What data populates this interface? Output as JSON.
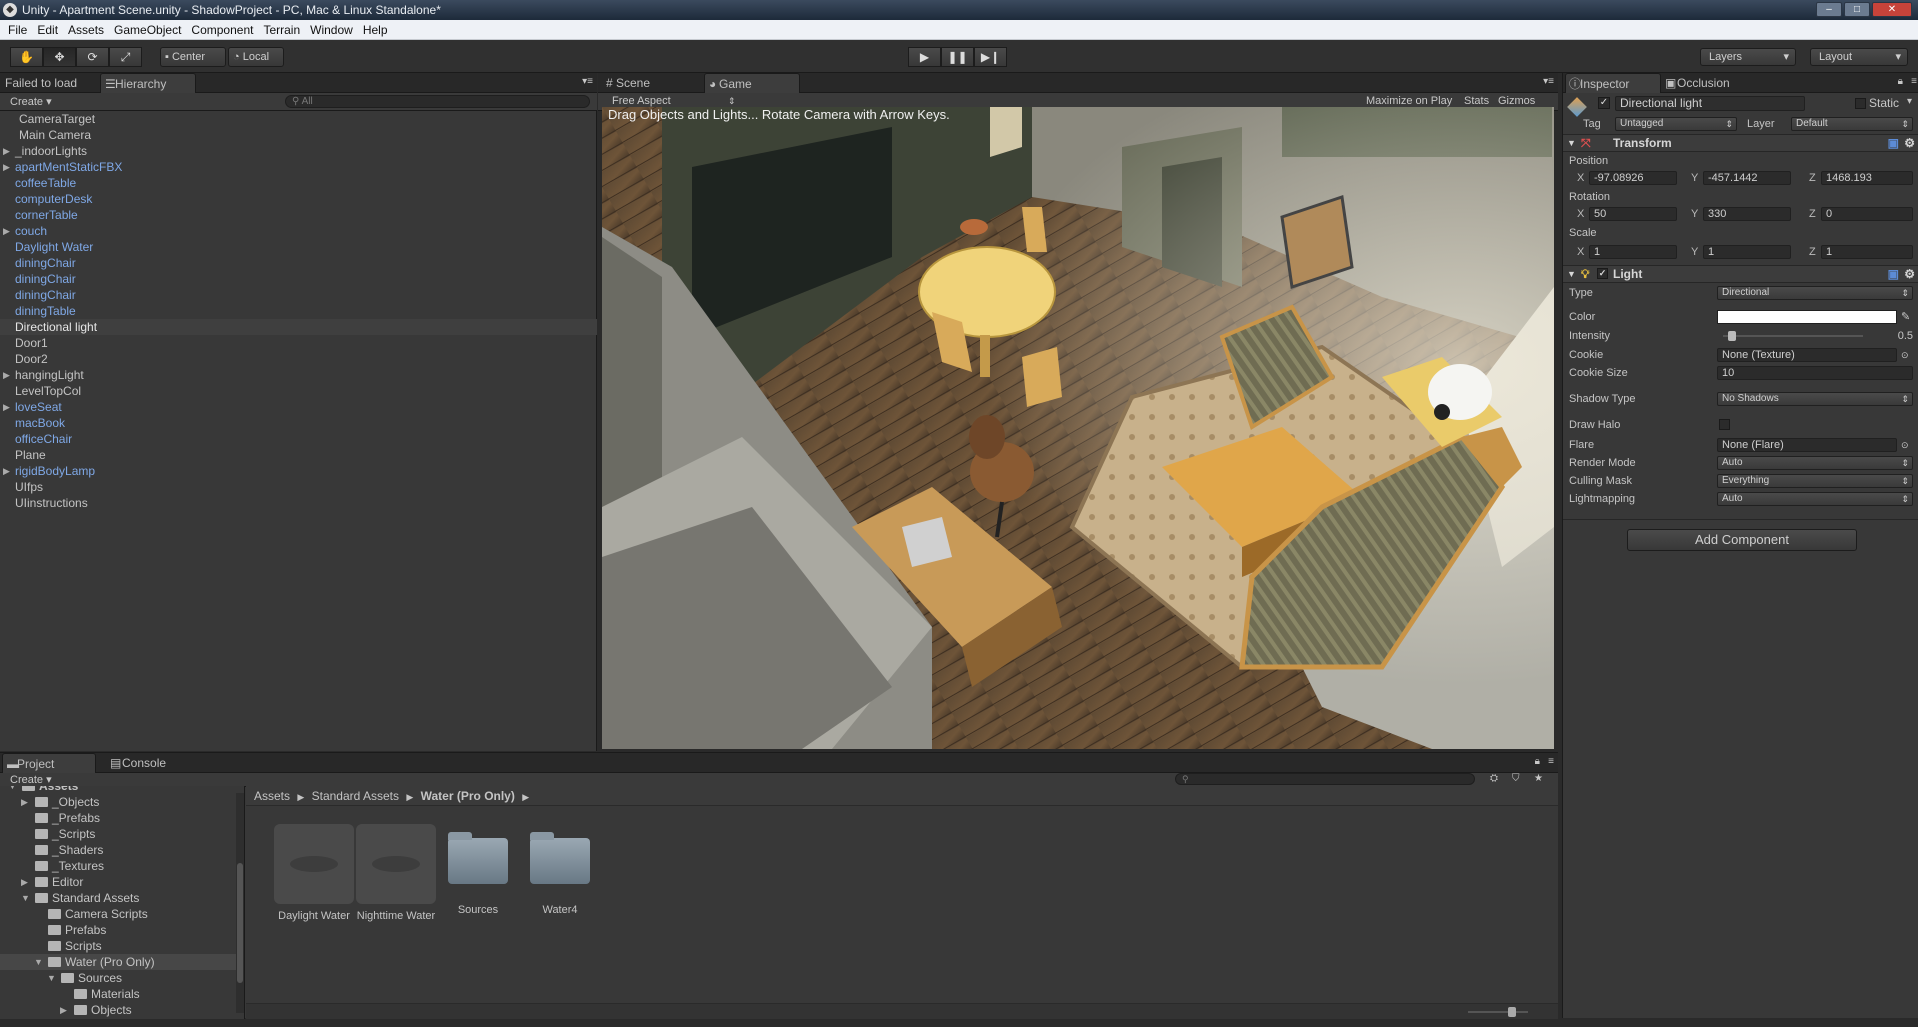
{
  "window": {
    "title": "Unity - Apartment Scene.unity - ShadowProject - PC, Mac & Linux Standalone*"
  },
  "menu": [
    "File",
    "Edit",
    "Assets",
    "GameObject",
    "Component",
    "Terrain",
    "Window",
    "Help"
  ],
  "toolbar": {
    "pivot_label": "Center",
    "space_label": "Local",
    "layers_label": "Layers",
    "layout_label": "Layout"
  },
  "hierarchy": {
    "failed_label": "Failed to load",
    "tab_label": "Hierarchy",
    "create_label": "Create",
    "search_placeholder": "All",
    "items": [
      {
        "label": "CameraTarget",
        "prefab": false,
        "expandable": false
      },
      {
        "label": "Main Camera",
        "prefab": false,
        "expandable": false
      },
      {
        "label": "_indoorLights",
        "prefab": false,
        "expandable": true
      },
      {
        "label": "apartMentStaticFBX",
        "prefab": true,
        "expandable": true
      },
      {
        "label": "coffeeTable",
        "prefab": true,
        "expandable": false
      },
      {
        "label": "computerDesk",
        "prefab": true,
        "expandable": false
      },
      {
        "label": "cornerTable",
        "prefab": true,
        "expandable": false
      },
      {
        "label": "couch",
        "prefab": true,
        "expandable": true
      },
      {
        "label": "Daylight Water",
        "prefab": true,
        "expandable": false
      },
      {
        "label": "diningChair",
        "prefab": true,
        "expandable": false
      },
      {
        "label": "diningChair",
        "prefab": true,
        "expandable": false
      },
      {
        "label": "diningChair",
        "prefab": true,
        "expandable": false
      },
      {
        "label": "diningTable",
        "prefab": true,
        "expandable": false
      },
      {
        "label": "Directional light",
        "prefab": false,
        "expandable": false,
        "selected": true
      },
      {
        "label": "Door1",
        "prefab": false,
        "expandable": false
      },
      {
        "label": "Door2",
        "prefab": false,
        "expandable": false
      },
      {
        "label": "hangingLight",
        "prefab": false,
        "expandable": true
      },
      {
        "label": "LevelTopCol",
        "prefab": false,
        "expandable": false
      },
      {
        "label": "loveSeat",
        "prefab": true,
        "expandable": true
      },
      {
        "label": "macBook",
        "prefab": true,
        "expandable": false
      },
      {
        "label": "officeChair",
        "prefab": true,
        "expandable": false
      },
      {
        "label": "Plane",
        "prefab": false,
        "expandable": false
      },
      {
        "label": "rigidBodyLamp",
        "prefab": true,
        "expandable": true
      },
      {
        "label": "UIfps",
        "prefab": false,
        "expandable": false
      },
      {
        "label": "UIinstructions",
        "prefab": false,
        "expandable": false
      }
    ]
  },
  "game": {
    "scene_tab": "Scene",
    "game_tab": "Game",
    "aspect_label": "Free Aspect",
    "maximize_label": "Maximize on Play",
    "stats_label": "Stats",
    "gizmos_label": "Gizmos",
    "instructions": "Drag Objects and Lights... Rotate Camera with Arrow Keys."
  },
  "inspector": {
    "tab_label": "Inspector",
    "occlusion_tab": "Occlusion",
    "object_name": "Directional light",
    "static_label": "Static",
    "tag_label": "Tag",
    "tag_value": "Untagged",
    "layer_label": "Layer",
    "layer_value": "Default",
    "transform": {
      "title": "Transform",
      "position_label": "Position",
      "position": {
        "x": "-97.08926",
        "y": "-457.1442",
        "z": "1468.193"
      },
      "rotation_label": "Rotation",
      "rotation": {
        "x": "50",
        "y": "330",
        "z": "0"
      },
      "scale_label": "Scale",
      "scale": {
        "x": "1",
        "y": "1",
        "z": "1"
      }
    },
    "axis": {
      "x": "X",
      "y": "Y",
      "z": "Z"
    },
    "light": {
      "title": "Light",
      "type_label": "Type",
      "type_value": "Directional",
      "color_label": "Color",
      "color_value": "#ffffff",
      "intensity_label": "Intensity",
      "intensity_value": "0.5",
      "intensity_fraction": 0.0625,
      "cookie_label": "Cookie",
      "cookie_value": "None (Texture)",
      "cookie_size_label": "Cookie Size",
      "cookie_size_value": "10",
      "shadow_type_label": "Shadow Type",
      "shadow_type_value": "No Shadows",
      "draw_halo_label": "Draw Halo",
      "flare_label": "Flare",
      "flare_value": "None (Flare)",
      "render_mode_label": "Render Mode",
      "render_mode_value": "Auto",
      "culling_mask_label": "Culling Mask",
      "culling_mask_value": "Everything",
      "lightmapping_label": "Lightmapping",
      "lightmapping_value": "Auto"
    },
    "add_component_label": "Add Component"
  },
  "project": {
    "tab_label": "Project",
    "console_tab": "Console",
    "create_label": "Create",
    "tree": [
      {
        "label": "Assets",
        "depth": 0,
        "expanded": true
      },
      {
        "label": "_Objects",
        "depth": 1,
        "expandable": true
      },
      {
        "label": "_Prefabs",
        "depth": 1
      },
      {
        "label": "_Scripts",
        "depth": 1
      },
      {
        "label": "_Shaders",
        "depth": 1
      },
      {
        "label": "_Textures",
        "depth": 1
      },
      {
        "label": "Editor",
        "depth": 1,
        "expandable": true
      },
      {
        "label": "Standard Assets",
        "depth": 1,
        "expanded": true
      },
      {
        "label": "Camera Scripts",
        "depth": 2
      },
      {
        "label": "Prefabs",
        "depth": 2
      },
      {
        "label": "Scripts",
        "depth": 2
      },
      {
        "label": "Water (Pro Only)",
        "depth": 2,
        "expanded": true,
        "selected": true
      },
      {
        "label": "Sources",
        "depth": 3,
        "expanded": true
      },
      {
        "label": "Materials",
        "depth": 4
      },
      {
        "label": "Objects",
        "depth": 4,
        "expandable": true
      }
    ],
    "breadcrumb": [
      "Assets",
      "Standard Assets",
      "Water (Pro Only)"
    ],
    "assets": [
      {
        "label": "Daylight Water",
        "kind": "prefab"
      },
      {
        "label": "Nighttime Water",
        "kind": "prefab"
      },
      {
        "label": "Sources",
        "kind": "folder"
      },
      {
        "label": "Water4",
        "kind": "folder"
      }
    ]
  },
  "colors": {
    "prefab_text": "#7fa8e6",
    "panel_bg": "#383838",
    "selection": "#474747"
  }
}
